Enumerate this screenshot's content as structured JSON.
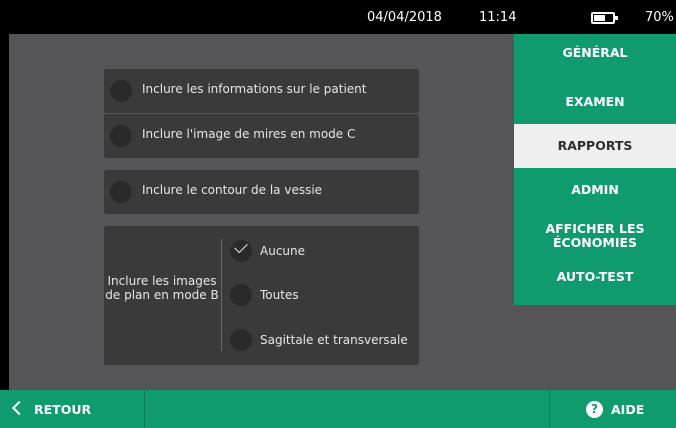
{
  "status": {
    "date": "04/04/2018",
    "time": "11:14",
    "battery_pct": "70%",
    "battery_level": 0.7
  },
  "options": [
    {
      "label": "Inclure les informations sur le patient",
      "checked": false
    },
    {
      "label": "Inclure l'image de mires en mode C",
      "checked": false
    },
    {
      "label": "Inclure le contour de la vessie",
      "checked": false
    }
  ],
  "bmode_group": {
    "label": "Inclure les images de plan en mode B",
    "choices": [
      {
        "label": "Aucune",
        "selected": true
      },
      {
        "label": "Toutes",
        "selected": false
      },
      {
        "label": "Sagittale et transversale",
        "selected": false
      }
    ]
  },
  "sidebar": {
    "tabs": [
      {
        "label": "GÉNÉRAL",
        "active": false
      },
      {
        "label": "EXAMEN",
        "active": false
      },
      {
        "label": "RAPPORTS",
        "active": true
      },
      {
        "label": "ADMIN",
        "active": false
      },
      {
        "label": "AFFICHER LES ÉCONOMIES",
        "active": false
      },
      {
        "label": "AUTO-TEST",
        "active": false
      }
    ]
  },
  "footer": {
    "back_label": "RETOUR",
    "help_label": "AIDE",
    "help_glyph": "?"
  },
  "colors": {
    "accent": "#0f9b6e",
    "panel": "#555557",
    "card": "#3a3a3b",
    "active_tab": "#efefef"
  }
}
